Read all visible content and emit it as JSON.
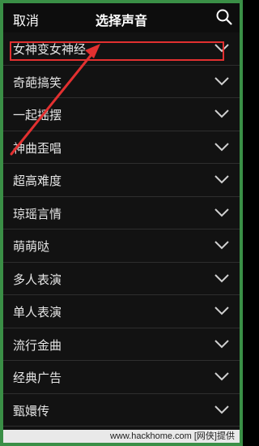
{
  "header": {
    "cancel_label": "取消",
    "title": "选择声音",
    "search_icon": "search-icon"
  },
  "categories": [
    {
      "label": "女神变女神经",
      "icon": "chevron-down-icon",
      "highlighted": true
    },
    {
      "label": "奇葩搞笑",
      "icon": "chevron-down-icon"
    },
    {
      "label": "一起摇摆",
      "icon": "chevron-down-icon"
    },
    {
      "label": "神曲歪唱",
      "icon": "chevron-down-icon"
    },
    {
      "label": "超高难度",
      "icon": "chevron-down-icon"
    },
    {
      "label": "琼瑶言情",
      "icon": "chevron-down-icon"
    },
    {
      "label": "萌萌哒",
      "icon": "chevron-down-icon"
    },
    {
      "label": "多人表演",
      "icon": "chevron-down-icon"
    },
    {
      "label": "单人表演",
      "icon": "chevron-down-icon"
    },
    {
      "label": "流行金曲",
      "icon": "chevron-down-icon"
    },
    {
      "label": "经典广告",
      "icon": "chevron-down-icon"
    },
    {
      "label": "甄嬛传",
      "icon": "chevron-down-icon"
    }
  ],
  "watermark": "www.hackhome.com [网侠]提供",
  "colors": {
    "background": "#121212",
    "frame": "#3a8f46",
    "annotation": "#e23030",
    "chevron": "#d0d0d0"
  }
}
